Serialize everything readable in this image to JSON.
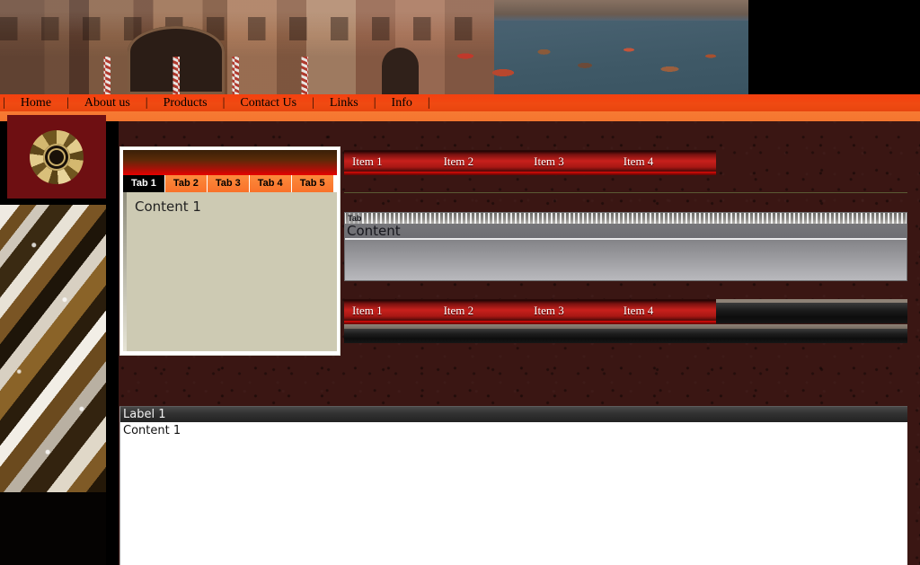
{
  "header": {
    "banner_alt": "venice-canal-photo"
  },
  "nav": {
    "separator": "|",
    "items": [
      {
        "label": "Home"
      },
      {
        "label": "About us"
      },
      {
        "label": "Products"
      },
      {
        "label": "Contact Us"
      },
      {
        "label": "Links"
      },
      {
        "label": "Info"
      }
    ]
  },
  "sidebar": {
    "logo_name": "ornamental-medallion-logo",
    "photo_name": "aerial-city-photo"
  },
  "tab_widget": {
    "tabs": [
      {
        "label": "Tab 1",
        "active": true
      },
      {
        "label": "Tab 2",
        "active": false
      },
      {
        "label": "Tab 3",
        "active": false
      },
      {
        "label": "Tab 4",
        "active": false
      },
      {
        "label": "Tab 5",
        "active": false
      }
    ],
    "content": "Content 1"
  },
  "menu_top": {
    "items": [
      {
        "label": "Item 1"
      },
      {
        "label": "Item 2"
      },
      {
        "label": "Item 3"
      },
      {
        "label": "Item 4"
      }
    ]
  },
  "menu_bottom": {
    "items": [
      {
        "label": "Item 1"
      },
      {
        "label": "Item 2"
      },
      {
        "label": "Item 3"
      },
      {
        "label": "Item 4"
      }
    ]
  },
  "gray_panel": {
    "tab_label": "Tab",
    "content_label": "Content"
  },
  "bottom_panel": {
    "label": "Label 1",
    "content": "Content 1"
  },
  "colors": {
    "nav_orange": "#f0450f",
    "nav_orange_light": "#f7762f",
    "page_maroon": "#3a1613",
    "logo_red": "#6e0f12",
    "item_red": "#c8201c",
    "tab_active_bg": "#000000",
    "tab_inactive_bg": "#f9722a",
    "tab_body_beige": "#cdcab3"
  }
}
